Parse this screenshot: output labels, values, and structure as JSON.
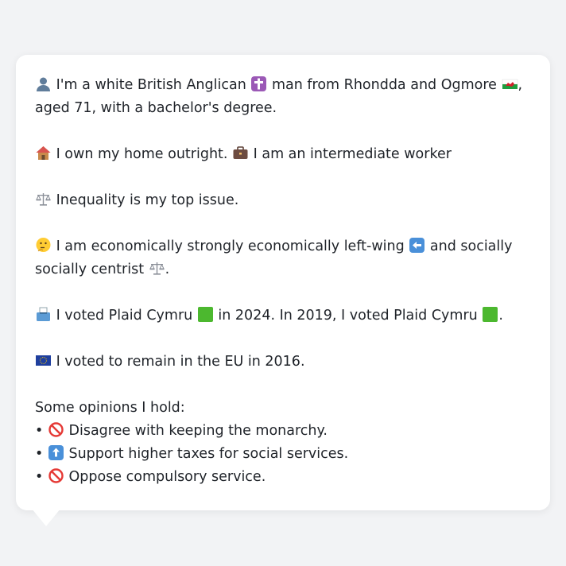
{
  "profile": {
    "line1": {
      "a": "I'm a white British Anglican",
      "b": "man from Rhondda and Ogmore",
      "c": ", aged 71, with a bachelor's degree."
    },
    "line2": {
      "a": "I own my home outright.",
      "b": "I am an intermediate worker"
    },
    "line3": {
      "a": "Inequality is my top issue."
    },
    "line4": {
      "a": "I am economically strongly economically left-wing",
      "b": "and socially socially centrist",
      "c": "."
    },
    "line5": {
      "a": "I voted Plaid Cymru",
      "b": "in 2024. In 2019, I voted Plaid Cymru",
      "c": "."
    },
    "line6": {
      "a": "I voted to remain in the EU in 2016."
    },
    "opinions_heading": "Some opinions I hold:",
    "opinions": [
      {
        "bullet": "•",
        "icon": "prohibited-icon",
        "text": "Disagree with keeping the monarchy."
      },
      {
        "bullet": "•",
        "icon": "up-arrow-icon",
        "text": "Support higher taxes for social services."
      },
      {
        "bullet": "•",
        "icon": "prohibited-icon",
        "text": "Oppose compulsory service."
      }
    ]
  },
  "icons": {
    "person": "person-icon",
    "cross": "latin-cross-icon",
    "wales-flag": "wales-flag-icon",
    "house": "house-icon",
    "briefcase": "briefcase-icon",
    "scales": "balance-scale-icon",
    "thinking": "thinking-face-icon",
    "left-arrow": "left-arrow-icon",
    "ballot": "ballot-box-icon",
    "green-square": "green-square-icon",
    "eu-flag": "eu-flag-icon"
  },
  "colors": {
    "background": "#f2f3f5",
    "card": "#ffffff",
    "text": "#1f2329",
    "party_green": "#4cb82f",
    "key_blue": "#4a90d9",
    "prohibited_red": "#e53935"
  }
}
